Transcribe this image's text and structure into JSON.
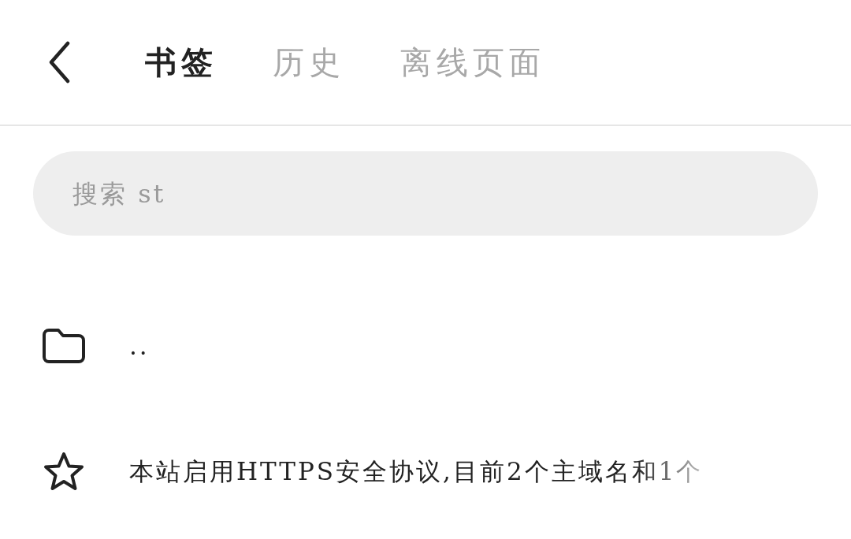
{
  "tabs": [
    {
      "label": "书签",
      "selected": true
    },
    {
      "label": "历史",
      "selected": false
    },
    {
      "label": "离线页面",
      "selected": false
    }
  ],
  "search": {
    "placeholder": "搜索 st"
  },
  "items": [
    {
      "kind": "folder",
      "title": ".."
    },
    {
      "kind": "bookmark",
      "title": "本站启用HTTPS安全协议,目前2个主域名和1个"
    }
  ]
}
